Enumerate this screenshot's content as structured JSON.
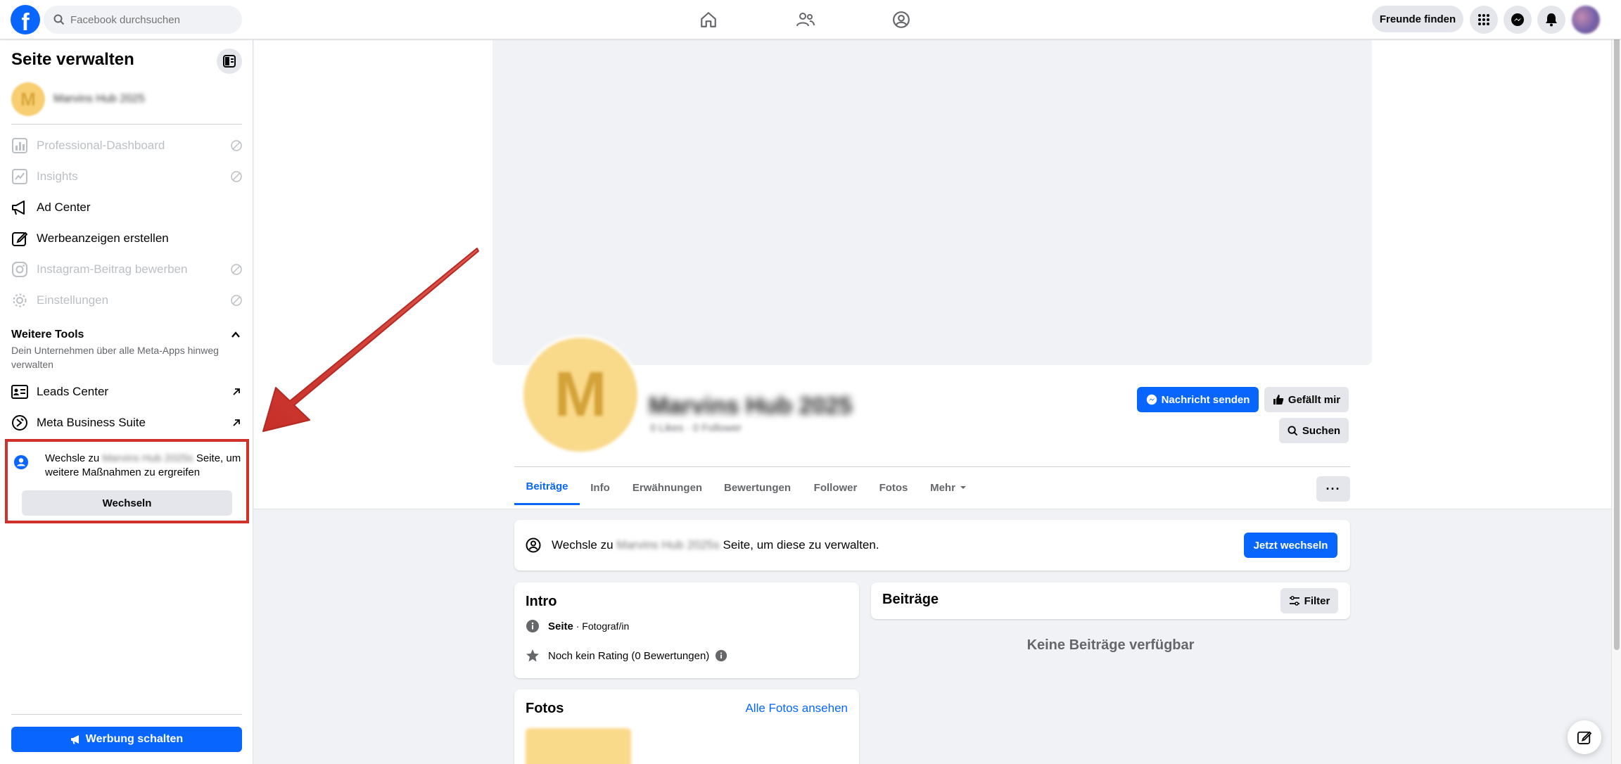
{
  "topbar": {
    "logo": "f",
    "search_placeholder": "Facebook durchsuchen",
    "find_friends": "Freunde finden"
  },
  "sidebar": {
    "title": "Seite verwalten",
    "page_initial": "M",
    "page_name": "Marvins Hub 2025",
    "menu": [
      {
        "label": "Professional-Dashboard",
        "icon": "dashboard-icon",
        "disabled": true
      },
      {
        "label": "Insights",
        "icon": "insights-icon",
        "disabled": true
      },
      {
        "label": "Ad Center",
        "icon": "megaphone-icon",
        "disabled": false
      },
      {
        "label": "Werbeanzeigen erstellen",
        "icon": "edit-icon",
        "disabled": false
      },
      {
        "label": "Instagram-Beitrag bewerben",
        "icon": "instagram-icon",
        "disabled": true
      },
      {
        "label": "Einstellungen",
        "icon": "gear-icon",
        "disabled": true
      }
    ],
    "tools_title": "Weitere Tools",
    "tools_desc": "Dein Unternehmen über alle Meta-Apps hinweg verwalten",
    "tools": [
      {
        "label": "Leads Center",
        "icon": "leads-icon"
      },
      {
        "label": "Meta Business Suite",
        "icon": "meta-business-icon"
      }
    ],
    "switch": {
      "prefix": "Wechsle zu",
      "page_name": "Marvins Hub 2025s",
      "suffix": "Seite, um weitere Maßnahmen zu ergreifen",
      "button": "Wechseln"
    },
    "ad_button": "Werbung schalten"
  },
  "profile": {
    "initial": "M",
    "name": "Marvins Hub 2025",
    "sub": "0 Likes · 0 Follower",
    "message_button": "Nachricht senden",
    "like_button": "Gefällt mir",
    "search_button": "Suchen"
  },
  "tabs": [
    "Beiträge",
    "Info",
    "Erwähnungen",
    "Bewertungen",
    "Follower",
    "Fotos",
    "Mehr"
  ],
  "notice": {
    "prefix": "Wechsle zu",
    "page_name": "Marvins Hub 2025s",
    "suffix": "Seite, um diese zu verwalten.",
    "button": "Jetzt wechseln"
  },
  "intro": {
    "title": "Intro",
    "page_label": "Seite",
    "page_category": " · Fotograf/in",
    "rating": "Noch kein Rating (0 Bewertungen)"
  },
  "posts": {
    "title": "Beiträge",
    "filter": "Filter",
    "empty": "Keine Beiträge verfügbar"
  },
  "photos": {
    "title": "Fotos",
    "link": "Alle Fotos ansehen"
  },
  "colors": {
    "brand": "#0866ff",
    "highlight_border": "#d0312d"
  }
}
